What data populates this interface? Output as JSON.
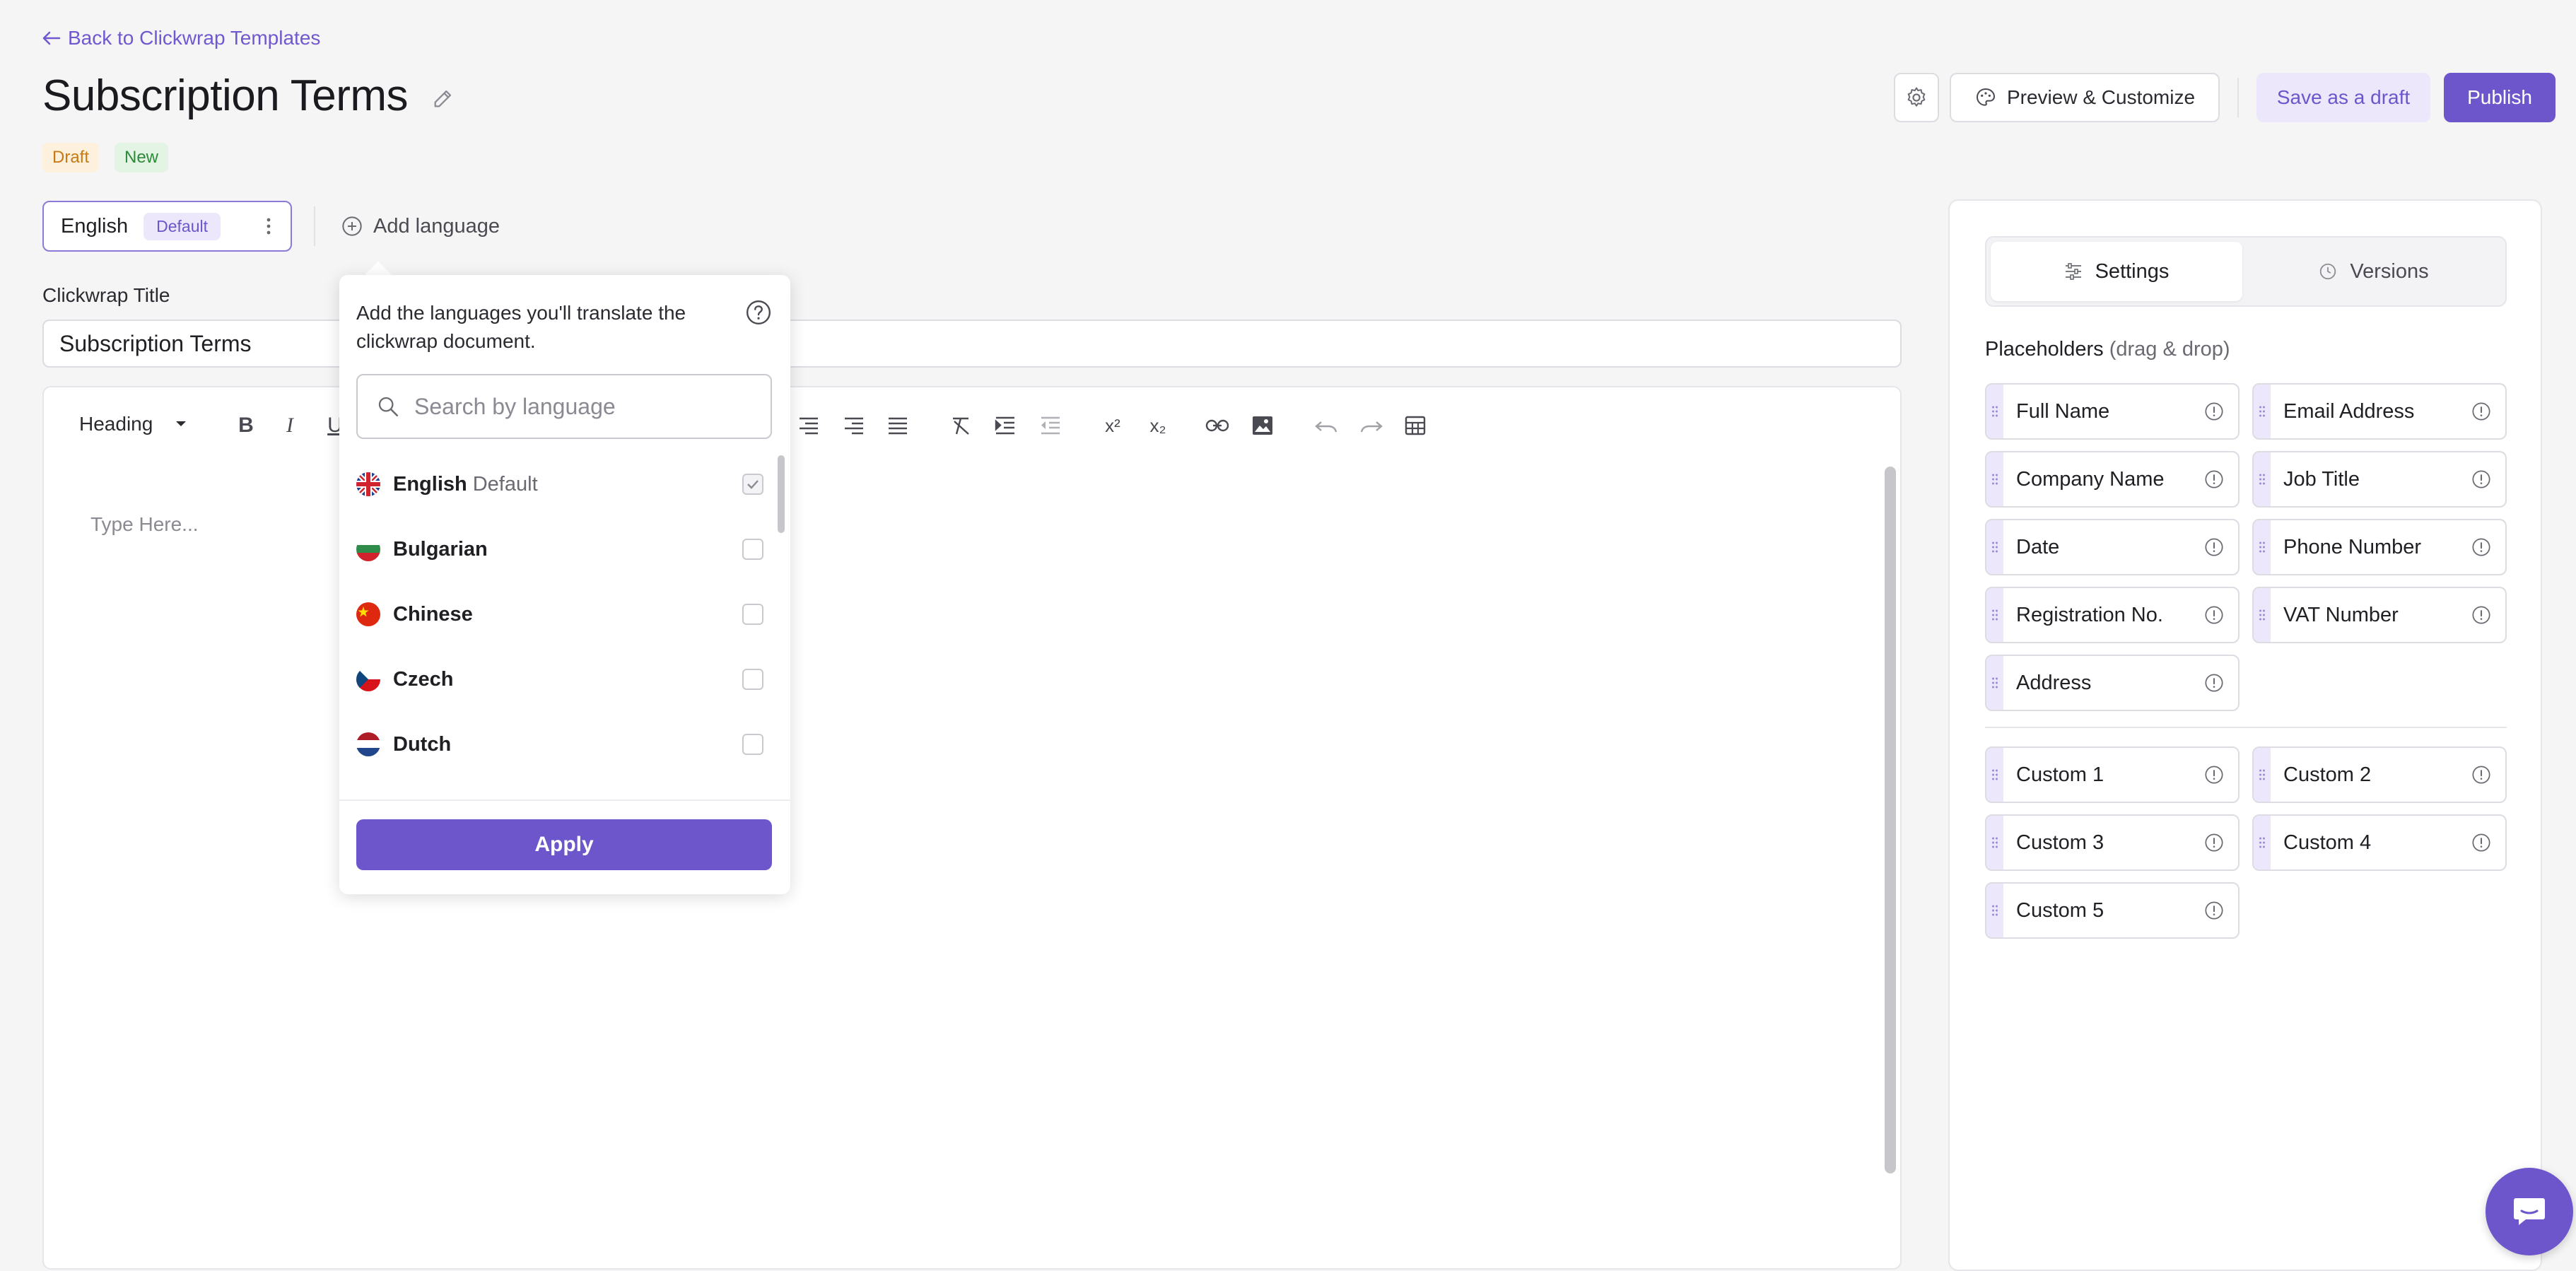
{
  "header": {
    "back_label": "Back to Clickwrap Templates",
    "title": "Subscription Terms",
    "badges": {
      "draft": "Draft",
      "new": "New"
    },
    "preview_label": "Preview & Customize",
    "save_draft_label": "Save as a draft",
    "publish_label": "Publish"
  },
  "languages": {
    "current": "English",
    "current_badge": "Default",
    "add_label": "Add language"
  },
  "form": {
    "title_label": "Clickwrap Title",
    "title_value": "Subscription Terms"
  },
  "editor": {
    "block_type": "Heading",
    "placeholder": "Type Here..."
  },
  "language_popup": {
    "description": "Add the languages you'll translate the clickwrap document.",
    "search_placeholder": "Search by language",
    "items": [
      {
        "name": "English",
        "sub": "Default",
        "checked": true,
        "flag": "uk-flag-icon"
      },
      {
        "name": "Bulgarian",
        "sub": "",
        "checked": false,
        "flag": "bulgaria-flag-icon"
      },
      {
        "name": "Chinese",
        "sub": "",
        "checked": false,
        "flag": "china-flag-icon"
      },
      {
        "name": "Czech",
        "sub": "",
        "checked": false,
        "flag": "czech-flag-icon"
      },
      {
        "name": "Dutch",
        "sub": "",
        "checked": false,
        "flag": "netherlands-flag-icon"
      }
    ],
    "apply_label": "Apply"
  },
  "right_panel": {
    "tabs": {
      "settings": "Settings",
      "versions": "Versions"
    },
    "placeholders_title": "Placeholders",
    "placeholders_hint": "(drag & drop)",
    "placeholders": [
      "Full Name",
      "Email Address",
      "Company Name",
      "Job Title",
      "Date",
      "Phone Number",
      "Registration No.",
      "VAT Number",
      "Address"
    ],
    "custom": [
      "Custom 1",
      "Custom 2",
      "Custom 3",
      "Custom 4",
      "Custom 5"
    ]
  },
  "colors": {
    "accent": "#6d56cc",
    "accent_light": "#ece7fb"
  }
}
